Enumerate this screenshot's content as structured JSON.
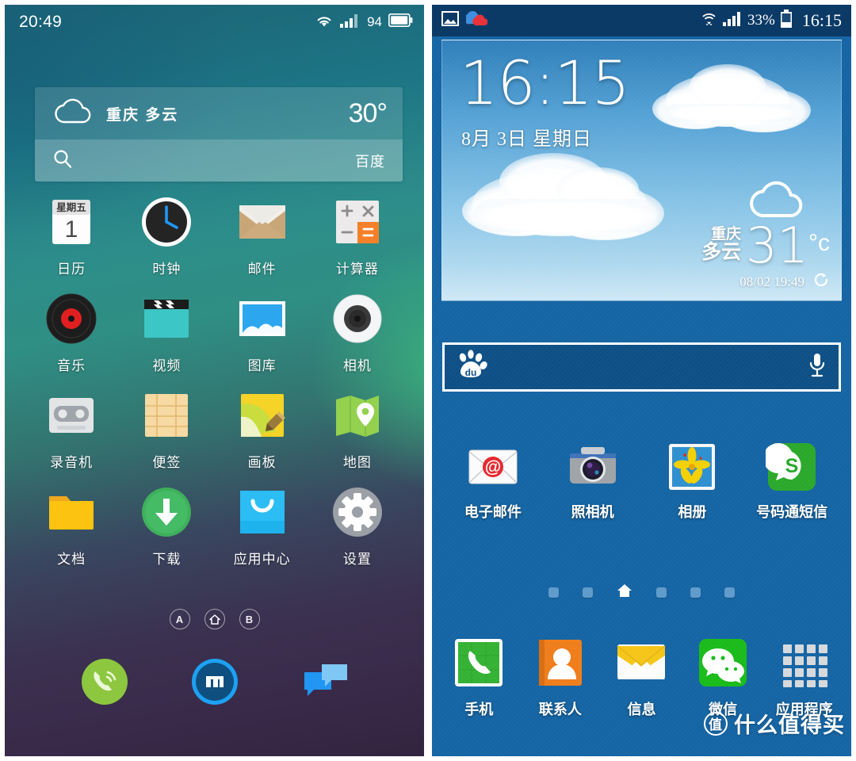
{
  "left_phone": {
    "status": {
      "time": "20:49",
      "battery_percent": "94",
      "wifi_icon": "wifi-icon",
      "signal_icon": "signal-icon",
      "battery_icon": "battery-icon"
    },
    "weather_widget": {
      "icon": "cloud-outline-icon",
      "location_condition": "重庆 多云",
      "temperature": "30°"
    },
    "search_widget": {
      "icon": "search-icon",
      "placeholder": "",
      "engine": "百度"
    },
    "apps": [
      {
        "label": "日历",
        "icon": "calendar-icon",
        "cal_weekday": "星期五",
        "cal_day": "1"
      },
      {
        "label": "时钟",
        "icon": "clock-icon"
      },
      {
        "label": "邮件",
        "icon": "mail-icon"
      },
      {
        "label": "计算器",
        "icon": "calculator-icon",
        "keys": [
          "+",
          "×",
          "−",
          "="
        ]
      },
      {
        "label": "音乐",
        "icon": "music-vinyl-icon"
      },
      {
        "label": "视频",
        "icon": "video-clapper-icon"
      },
      {
        "label": "图库",
        "icon": "gallery-icon"
      },
      {
        "label": "相机",
        "icon": "camera-icon"
      },
      {
        "label": "录音机",
        "icon": "recorder-cassette-icon"
      },
      {
        "label": "便签",
        "icon": "notes-icon"
      },
      {
        "label": "画板",
        "icon": "drawing-board-icon"
      },
      {
        "label": "地图",
        "icon": "map-icon"
      },
      {
        "label": "文档",
        "icon": "folder-icon"
      },
      {
        "label": "下载",
        "icon": "download-icon"
      },
      {
        "label": "应用中心",
        "icon": "app-store-bag-icon"
      },
      {
        "label": "设置",
        "icon": "settings-gear-icon"
      }
    ],
    "page_indicators": [
      {
        "label": "A",
        "icon": "page-a-icon",
        "active": false
      },
      {
        "label": "",
        "icon": "home-icon",
        "active": true
      },
      {
        "label": "B",
        "icon": "page-b-icon",
        "active": false
      }
    ],
    "dock": [
      {
        "name": "phone",
        "icon": "phone-dialer-icon"
      },
      {
        "name": "flyme",
        "icon": "flyme-m-icon"
      },
      {
        "name": "messages",
        "icon": "messages-bubble-icon"
      }
    ]
  },
  "right_phone": {
    "status": {
      "notification_icons": [
        "screenshot-image-icon",
        "cloud-sync-icon"
      ],
      "wifi_icon": "wifi-icon",
      "signal_icon": "signal-icon",
      "battery_percent": "33%",
      "battery_icon": "battery-icon",
      "time": "16:15"
    },
    "clock_widget": {
      "time": "16:15",
      "date": "8月 3日 星期日"
    },
    "weather_widget": {
      "icon": "cloud-outline-icon",
      "city": "重庆",
      "condition": "多云",
      "temperature": "31",
      "unit": "°c",
      "updated": "08/02 19:49",
      "refresh_icon": "refresh-icon"
    },
    "search_widget": {
      "logo": "baidu-paw-icon",
      "logo_text": "du",
      "value": "",
      "mic_icon": "microphone-icon"
    },
    "apps": [
      {
        "label": "电子邮件",
        "icon": "email-at-envelope-icon"
      },
      {
        "label": "照相机",
        "icon": "camera-body-icon"
      },
      {
        "label": "相册",
        "icon": "photo-album-flower-icon"
      },
      {
        "label": "号码通短信",
        "icon": "sogou-sms-icon"
      }
    ],
    "page_indicators": [
      {
        "icon": "page-dot-icon",
        "active": false
      },
      {
        "icon": "page-dot-icon",
        "active": false
      },
      {
        "icon": "home-page-icon",
        "active": true
      },
      {
        "icon": "page-dot-icon",
        "active": false
      },
      {
        "icon": "page-dot-icon",
        "active": false
      },
      {
        "icon": "page-dot-icon",
        "active": false
      }
    ],
    "dock": [
      {
        "label": "手机",
        "icon": "phone-handset-icon"
      },
      {
        "label": "联系人",
        "icon": "contacts-person-icon"
      },
      {
        "label": "信息",
        "icon": "messages-envelope-icon"
      },
      {
        "label": "微信",
        "icon": "wechat-icon"
      },
      {
        "label": "应用程序",
        "icon": "app-drawer-grid-icon"
      }
    ],
    "watermark": {
      "badge": "值",
      "text": "什么值得买"
    }
  }
}
